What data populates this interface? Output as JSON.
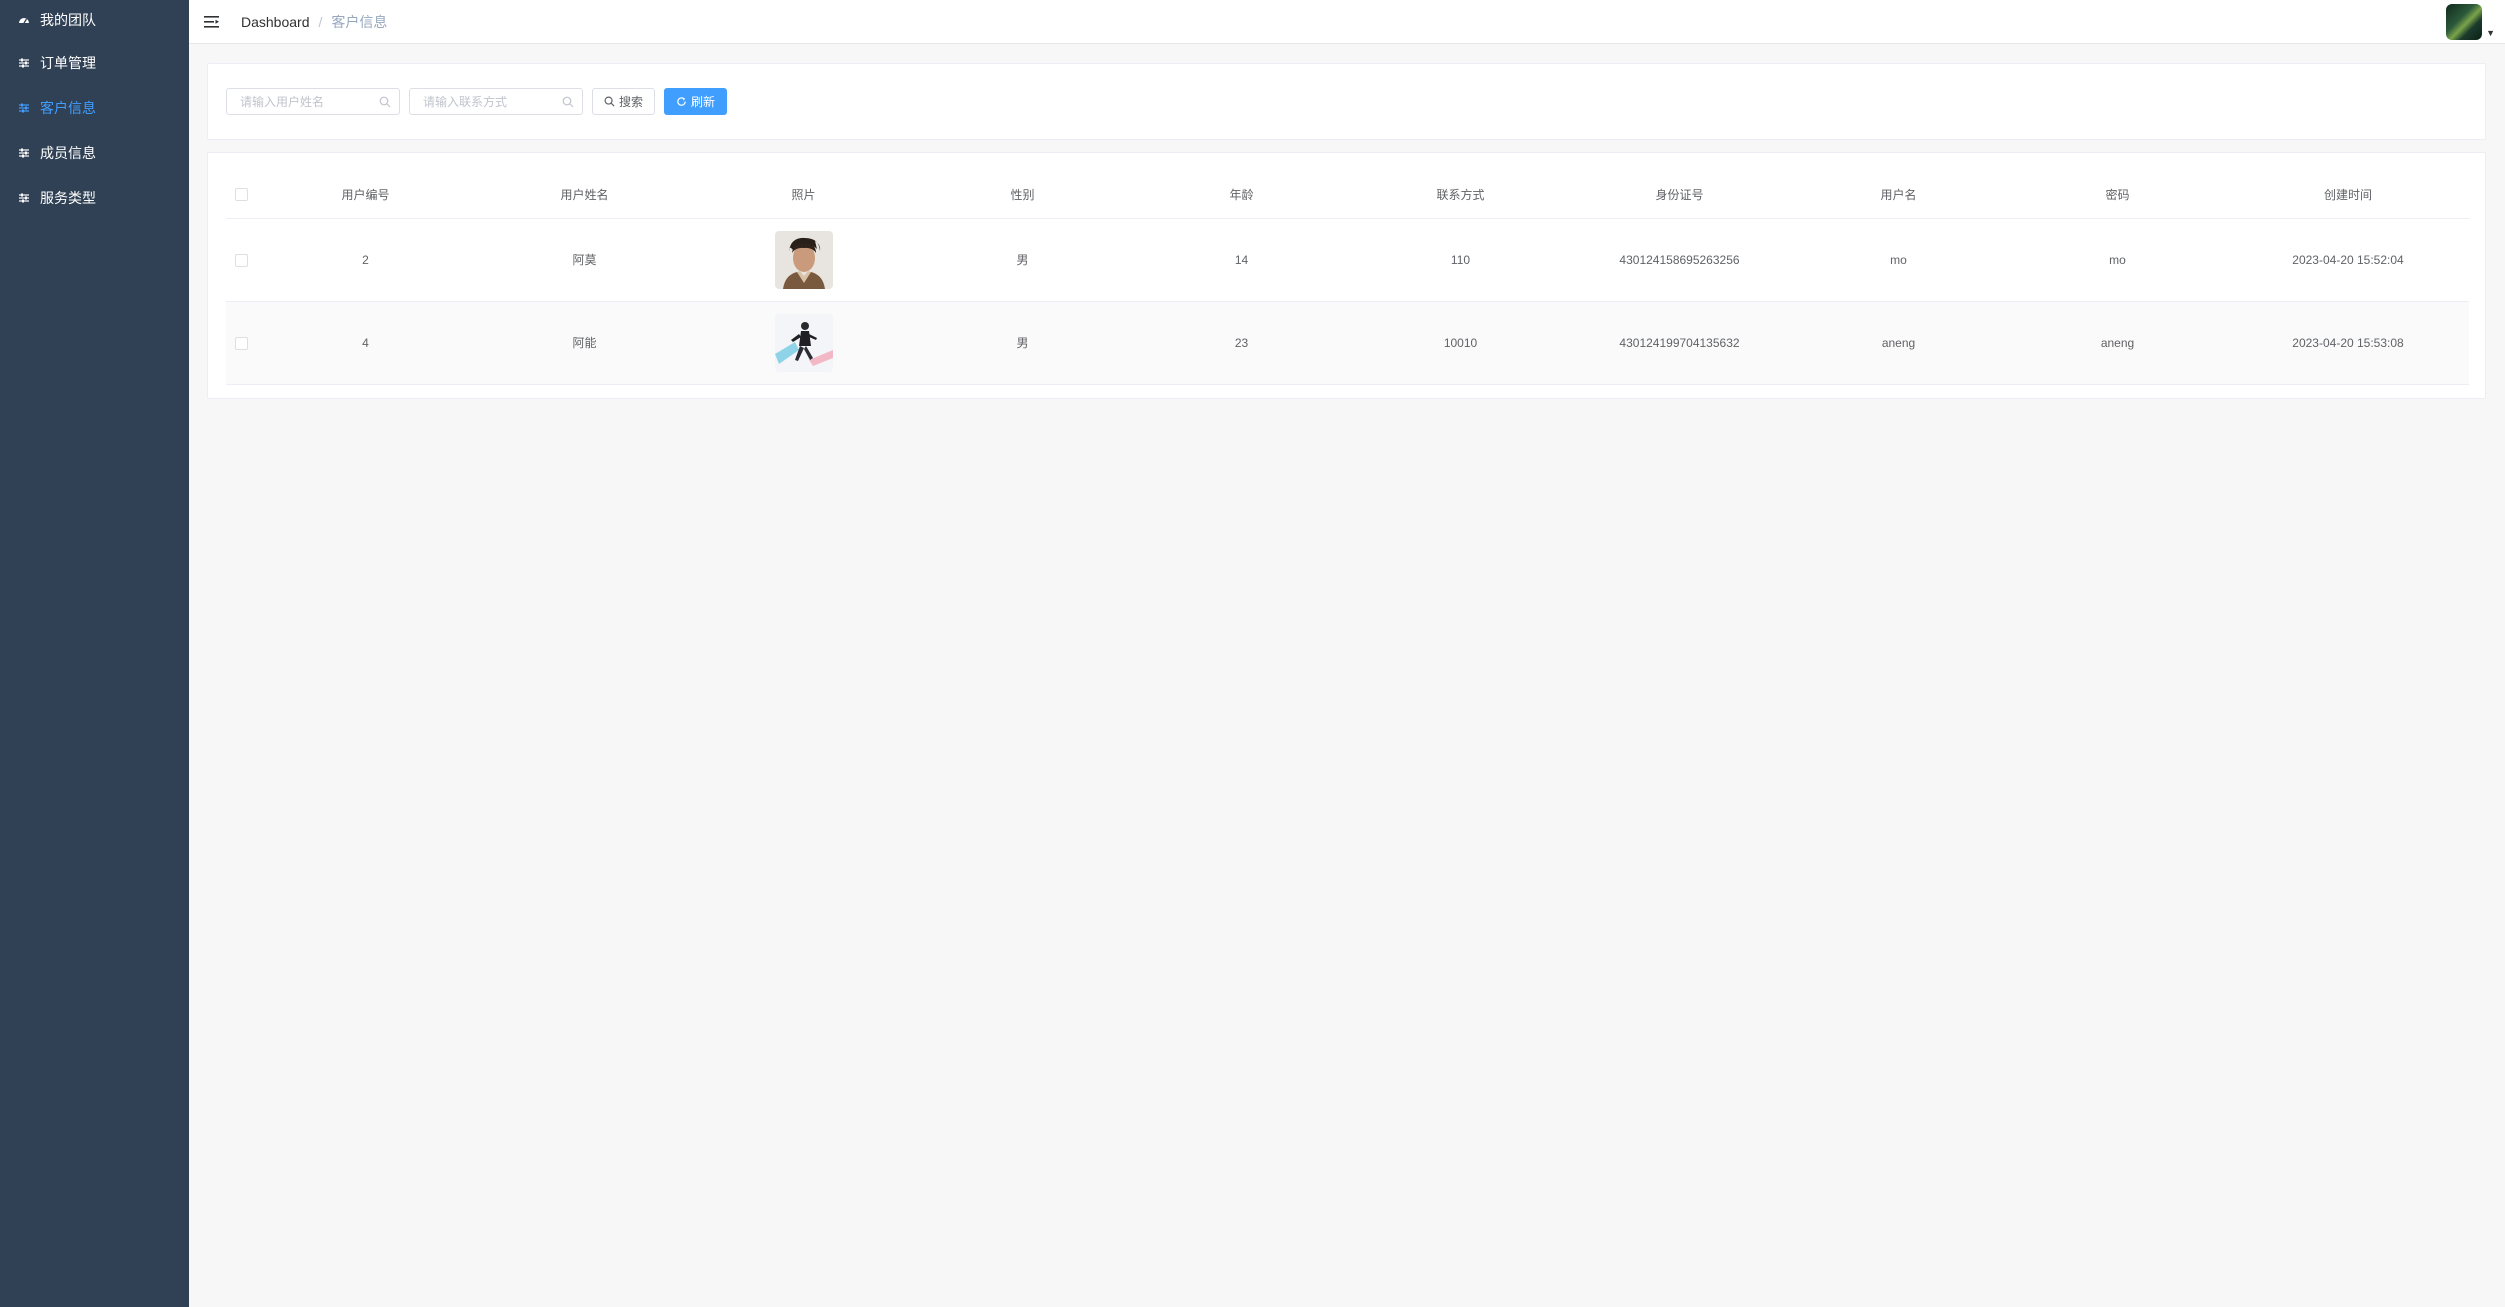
{
  "sidebar": {
    "items": [
      {
        "label": "我的团队",
        "icon": "dashboard-icon",
        "active": false
      },
      {
        "label": "订单管理",
        "icon": "sliders-icon",
        "active": false
      },
      {
        "label": "客户信息",
        "icon": "sliders-icon",
        "active": true
      },
      {
        "label": "成员信息",
        "icon": "sliders-icon",
        "active": false
      },
      {
        "label": "服务类型",
        "icon": "sliders-icon",
        "active": false
      }
    ]
  },
  "navbar": {
    "breadcrumb": {
      "home": "Dashboard",
      "separator": "/",
      "current": "客户信息"
    }
  },
  "search": {
    "name_placeholder": "请输入用户姓名",
    "contact_placeholder": "请输入联系方式",
    "search_label": "搜索",
    "refresh_label": "刷新"
  },
  "table": {
    "headers": [
      "用户编号",
      "用户姓名",
      "照片",
      "性别",
      "年龄",
      "联系方式",
      "身份证号",
      "用户名",
      "密码",
      "创建时间"
    ],
    "rows": [
      {
        "id": "2",
        "name": "阿莫",
        "gender": "男",
        "age": "14",
        "contact": "110",
        "id_card": "430124158695263256",
        "username": "mo",
        "password": "mo",
        "created": "2023-04-20 15:52:04"
      },
      {
        "id": "4",
        "name": "阿能",
        "gender": "男",
        "age": "23",
        "contact": "10010",
        "id_card": "430124199704135632",
        "username": "aneng",
        "password": "aneng",
        "created": "2023-04-20 15:53:08"
      }
    ]
  },
  "colors": {
    "sidebar_bg": "#304156",
    "accent": "#409eff",
    "text": "#606266"
  }
}
